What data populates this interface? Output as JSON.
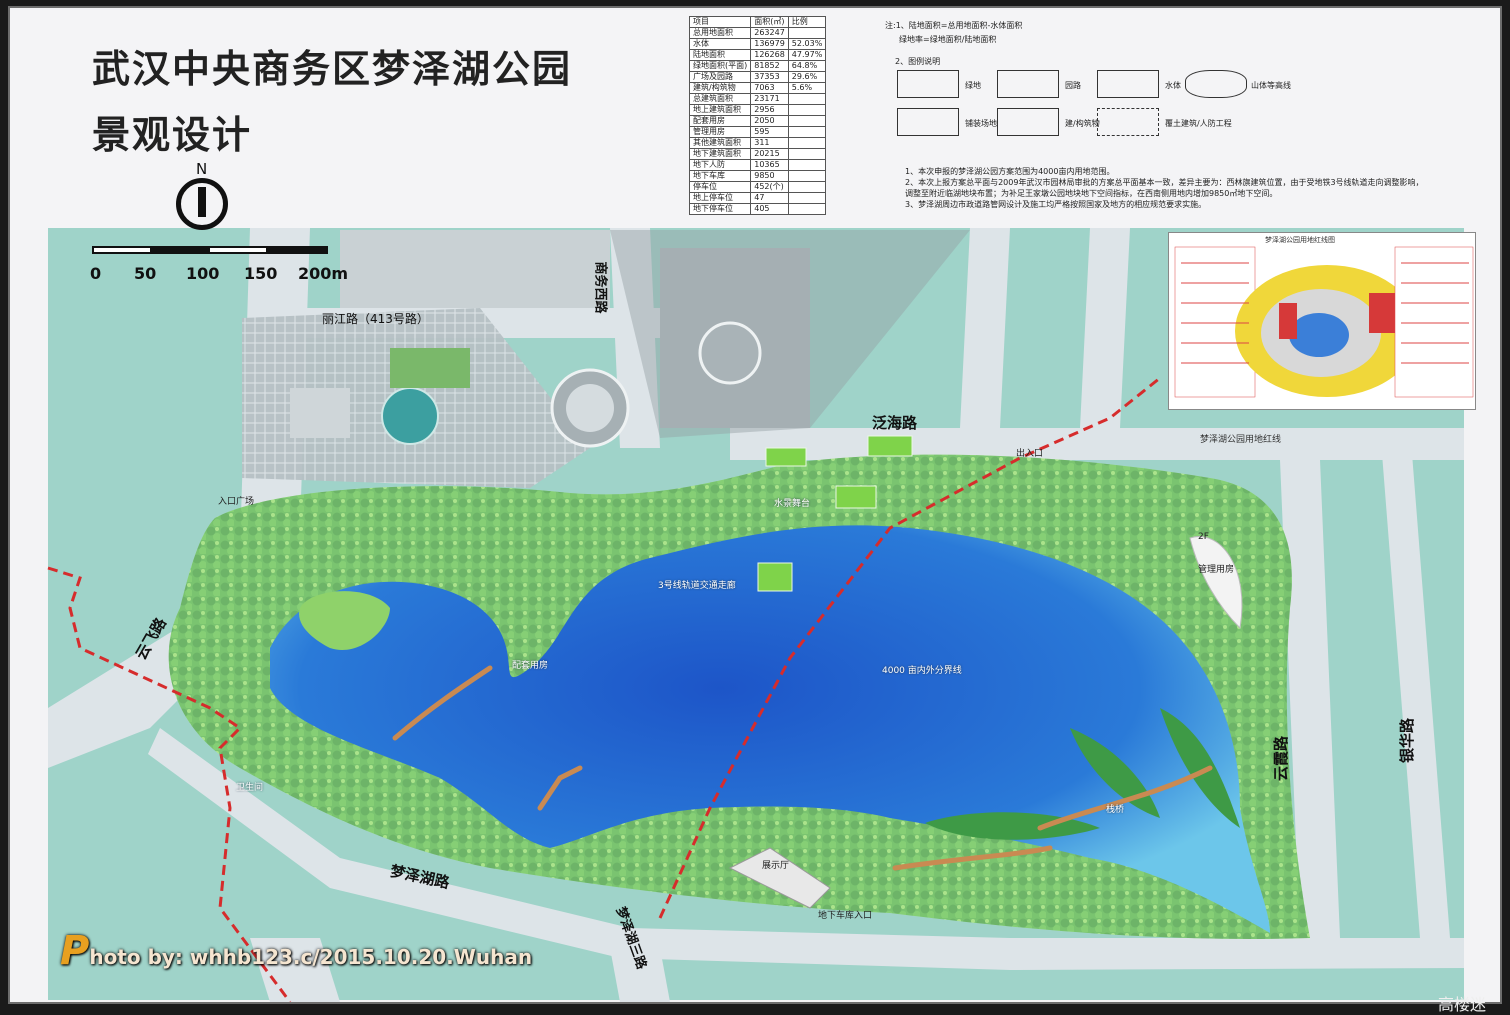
{
  "title": {
    "line1": "武汉中央商务区梦泽湖公园",
    "line2": "景观设计"
  },
  "north": {
    "label": "N"
  },
  "scale_bar": {
    "ticks": [
      "0",
      "50",
      "100",
      "150",
      "200m"
    ]
  },
  "stats_table": {
    "headers": [
      "项目",
      "面积(㎡)",
      "比例"
    ],
    "rows": [
      [
        "总用地面积",
        "263247",
        ""
      ],
      [
        "水体",
        "136979",
        "52.03%"
      ],
      [
        "陆地面积",
        "126268",
        "47.97%"
      ],
      [
        "绿地面积(平面)",
        "81852",
        "64.8%"
      ],
      [
        "广场及园路",
        "37353",
        "29.6%"
      ],
      [
        "建筑/构筑物",
        "7063",
        "5.6%"
      ],
      [
        "总建筑面积",
        "23171",
        ""
      ],
      [
        "地上建筑面积",
        "2956",
        ""
      ],
      [
        "配套用房",
        "2050",
        ""
      ],
      [
        "管理用房",
        "595",
        ""
      ],
      [
        "其他建筑面积",
        "311",
        ""
      ],
      [
        "地下建筑面积",
        "20215",
        ""
      ],
      [
        "地下人防",
        "10365",
        ""
      ],
      [
        "地下车库",
        "9850",
        ""
      ],
      [
        "停车位",
        "452(个)",
        ""
      ],
      [
        "地上停车位",
        "47",
        ""
      ],
      [
        "地下停车位",
        "405",
        ""
      ]
    ]
  },
  "legend": {
    "header_note": "注:1、陆地面积=总用地面积-水体面积",
    "header_note2": "绿地率=绿地面积/陆地面积",
    "section": "2、图例说明",
    "items": [
      {
        "label": "绿地",
        "pattern": "dots"
      },
      {
        "label": "园路",
        "pattern": "lines"
      },
      {
        "label": "水体",
        "pattern": "hatch"
      },
      {
        "label": "山体等高线",
        "pattern": "contour"
      },
      {
        "label": "铺装场地",
        "pattern": "paving"
      },
      {
        "label": "建/构筑物",
        "pattern": "stripes"
      },
      {
        "label": "覆土建筑/人防工程",
        "pattern": "dashed"
      }
    ],
    "notes": [
      "3、",
      "1、本次申报的梦泽湖公园方案范围为4000亩内用地范围。",
      "2、本次上报方案总平面与2009年武汉市园林局审批的方案总平面基本一致，差异主要为：西林旗建筑位置，由于受地铁3号线轨道走向调整影响，",
      "调整至附近临湖地块布置；为补足王家墩公园地块地下空间指标，在西南侧用地内增加9850㎡地下空间。",
      "3、梦泽湖周边市政道路管网设计及施工均严格按照国家及地方的相应规范要求实施。"
    ]
  },
  "roads": {
    "north": "泛海路",
    "south": "梦泽湖路",
    "west": "云飞路",
    "east": "云霞路",
    "east2": "银华路",
    "north_west": "商务西路",
    "north_road": "丽江路（413号路）",
    "south2": "梦泽湖三路"
  },
  "map_labels": {
    "boundary": "梦泽湖公园用地红线",
    "district_line": "4000 亩内外分界线",
    "metro": "3号线轨道交通走廊",
    "management": "管理用房",
    "exhibition": "展示厅",
    "underground_entrance": "地下车库入口",
    "entrance": "出入口",
    "entrance_plaza": "入口广场",
    "stage": "水景舞台",
    "bridge": "栈桥",
    "toilet": "卫生间",
    "service": "配套用房",
    "floors": "2F"
  },
  "inset_title": "梦泽湖公园用地红线图",
  "watermark": {
    "mark": "P",
    "text": "hoto by: whhb123.c/2015.10.20.Wuhan"
  },
  "brand": "高楼迷",
  "colors": {
    "water": "#1e6fd0",
    "grass": "#6fc63d",
    "trees": "#2e8d3f",
    "ground": "#9fd3c9",
    "road": "#dfe6ea",
    "boundary": "#d62c2c"
  }
}
